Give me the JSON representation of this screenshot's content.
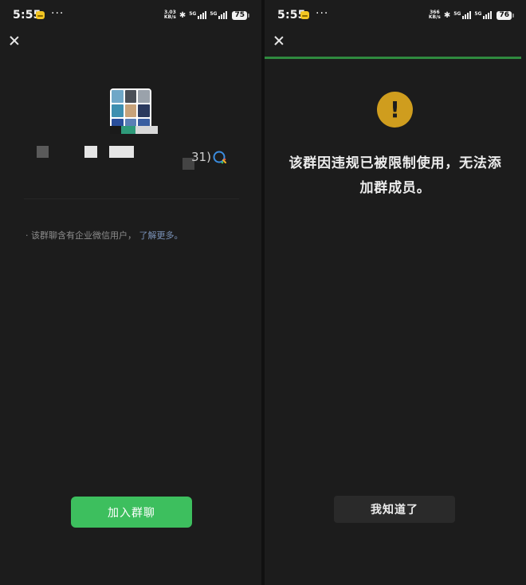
{
  "left": {
    "status": {
      "time": "5:55",
      "dots": "···",
      "net_speed_value": "3.03",
      "net_speed_unit": "KB/s",
      "bluetooth": "✱",
      "sig1": "5G",
      "sig2": "5G",
      "battery": "75"
    },
    "group_count_fragment": "31)",
    "notice_text": "· 该群聊含有企业微信用户，",
    "notice_link": "了解更多。",
    "join_button": "加入群聊"
  },
  "right": {
    "status": {
      "time": "5:55",
      "dots": "···",
      "net_speed_value": "366",
      "net_speed_unit": "KB/s",
      "bluetooth": "✱",
      "sig1": "5G",
      "sig2": "5G",
      "battery": "76"
    },
    "progress_percent": 100,
    "warning_symbol": "!",
    "warning_line1": "该群因违规已被限制使用，无法添",
    "warning_line2": "加群成员。",
    "ok_button": "我知道了"
  },
  "colors": {
    "accent_green": "#3dbf5e",
    "warning_yellow": "#cf9d1e",
    "link_blue": "#7a92b8",
    "background": "#1c1c1c"
  },
  "icons": [
    "close-icon",
    "wework-icon",
    "warning-icon",
    "bluetooth-icon",
    "battery-icon",
    "signal-icon"
  ]
}
